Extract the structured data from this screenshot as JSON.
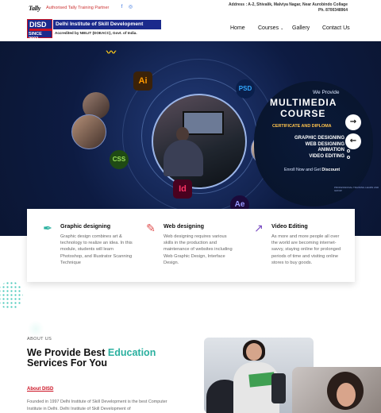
{
  "top": {
    "brand": "Tally",
    "partner": "Authorised Tally Training Partner",
    "address": "Address : A-2, Shivalik, Malviya Nagar, Near Aurobindo Collage",
    "phone": "Ph. 8700348964",
    "social": [
      "facebook-icon",
      "instagram-icon"
    ]
  },
  "logo": {
    "short": "DISD",
    "mini": "Computer Education",
    "since": "SINCE 2002",
    "name": "Delhi Institute of Skill Development",
    "accreditation": "Accredited by NIELIT (DOEACC), Govt. of India."
  },
  "nav": {
    "items": [
      "Home",
      "Courses",
      "Gallery",
      "Contact Us"
    ],
    "courses_chevron": "⌄"
  },
  "hero": {
    "we_provide": "We Provide",
    "title_line1": "MULTIMEDIA",
    "title_line2": "COURSE",
    "certificate": "CERTIFICATE AND DIPLOMA",
    "courses": [
      "GRAPHIC DESIGNING",
      "WEB DESIGNING",
      "ANIMATION",
      "VIDEO EDITING"
    ],
    "enroll": "Enroll Now and Get",
    "discount": "Discount",
    "small_brand": "PROFESSIONAL TRAINING LEARN AND GROW",
    "icons": [
      "Ai",
      "PSD",
      "CSS",
      "Id",
      "Ae"
    ],
    "squiggle": "〰",
    "next_arrow": "→",
    "prev_arrow": "←"
  },
  "features": [
    {
      "title": "Graphic designing",
      "text": "Graphic design combines art & technology to realize an idea. In this module, students will learn Photoshop, and Illustrator Scanning Technique",
      "icon": "pen-icon"
    },
    {
      "title": "Web designing",
      "text": "Web designing requires various skills in the production and maintenance of websites including Web Graphic Design, Interface Design.",
      "icon": "web-icon"
    },
    {
      "title": "Video Editing",
      "text": "As more and more people all over the world are becoming internet-savvy, staying online for prolonged periods of time and visiting online stores to buy goods.",
      "icon": "video-icon"
    }
  ],
  "about": {
    "label": "ABOUT US",
    "heading_prefix": "We Provide Best",
    "heading_highlight": "Education",
    "heading_line2": "Services For You",
    "link": "About DISD",
    "text": "Founded in 1997 Delhi Institute of Skill Development is the best Computer Institute in Delhi. Delhi Institute of Skill Development of"
  },
  "colors": {
    "brand_blue": "#1b2a8c",
    "brand_red": "#cc1122",
    "accent_teal": "#2ab09f",
    "hero_bg": "#0d1b42",
    "button_bg": "#ffffff"
  }
}
